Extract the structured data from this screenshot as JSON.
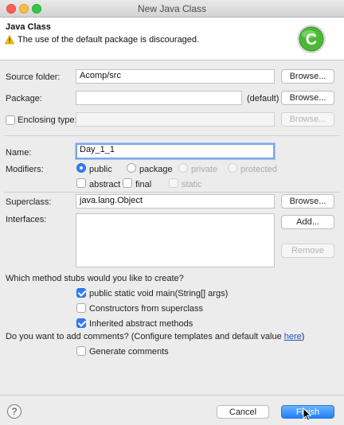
{
  "window": {
    "title": "New Java Class"
  },
  "banner": {
    "title": "Java Class",
    "message": "The use of the default package is discouraged."
  },
  "source_folder": {
    "label": "Source folder:",
    "value": "Acomp/src",
    "browse": "Browse..."
  },
  "package": {
    "label": "Package:",
    "value": "",
    "default_label": "(default)",
    "browse": "Browse..."
  },
  "enclosing_type": {
    "label": "Enclosing type:",
    "value": "",
    "browse": "Browse..."
  },
  "name": {
    "label": "Name:",
    "value": "Day_1_1"
  },
  "modifiers": {
    "label": "Modifiers:",
    "public": "public",
    "package": "package",
    "private": "private",
    "protected": "protected",
    "abstract": "abstract",
    "final": "final",
    "static": "static"
  },
  "superclass": {
    "label": "Superclass:",
    "value": "java.lang.Object",
    "browse": "Browse..."
  },
  "interfaces": {
    "label": "Interfaces:",
    "add": "Add...",
    "remove": "Remove"
  },
  "stubs": {
    "question": "Which method stubs would you like to create?",
    "main": "public static void main(String[] args)",
    "constructors": "Constructors from superclass",
    "inherited": "Inherited abstract methods"
  },
  "comments": {
    "question_prefix": "Do you want to add comments? (Configure templates and default value ",
    "link": "here",
    "question_suffix": ")",
    "generate": "Generate comments"
  },
  "footer": {
    "help": "?",
    "cancel": "Cancel",
    "finish": "Finish"
  },
  "colors": {
    "accent": "#2f7ef8",
    "logo": "#4cb837",
    "warning": "#f5c400"
  }
}
